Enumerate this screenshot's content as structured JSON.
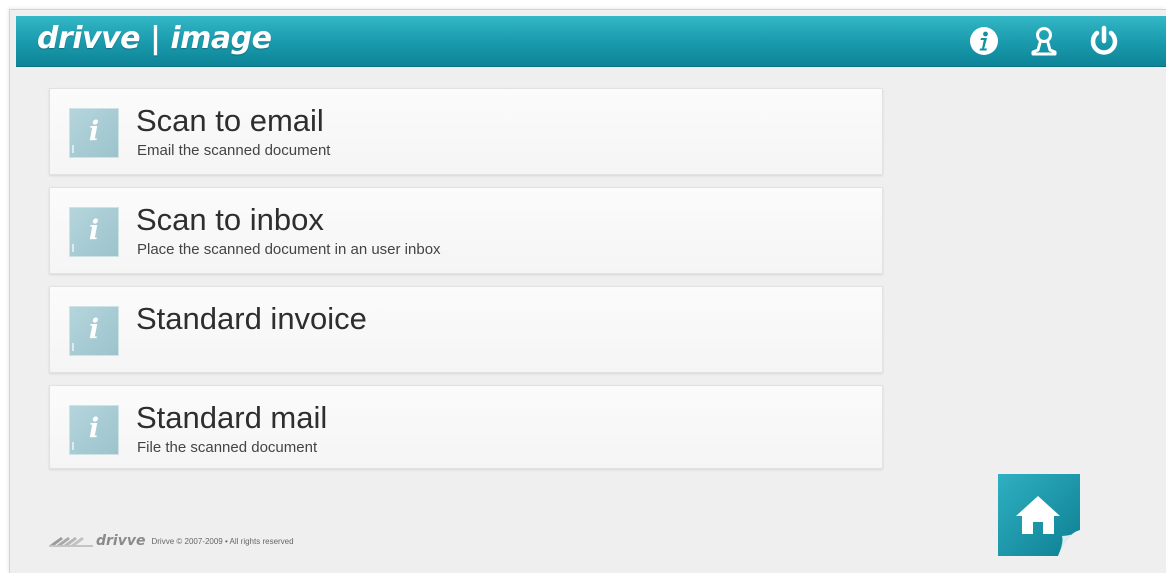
{
  "app": {
    "brand": "drivve | image"
  },
  "header": {
    "icons": [
      "info-icon",
      "user-icon",
      "power-icon"
    ]
  },
  "tiles": [
    {
      "title": "Scan to email",
      "subtitle": "Email the scanned document",
      "icon": "info-icon"
    },
    {
      "title": "Scan to inbox",
      "subtitle": "Place the scanned document in an user inbox",
      "icon": "info-icon"
    },
    {
      "title": "Standard invoice",
      "subtitle": "",
      "icon": "info-icon"
    },
    {
      "title": "Standard mail",
      "subtitle": "File the scanned document",
      "icon": "info-icon"
    }
  ],
  "footer": {
    "wordmark": "drivve",
    "copyright": "Drivve © 2007-2009 • All rights reserved"
  },
  "home": {
    "icon": "home-icon"
  },
  "colors": {
    "header_top": "#34b7c6",
    "header_bottom": "#0d8497",
    "tile_icon": "#a9ccd4",
    "background": "#efefef"
  }
}
